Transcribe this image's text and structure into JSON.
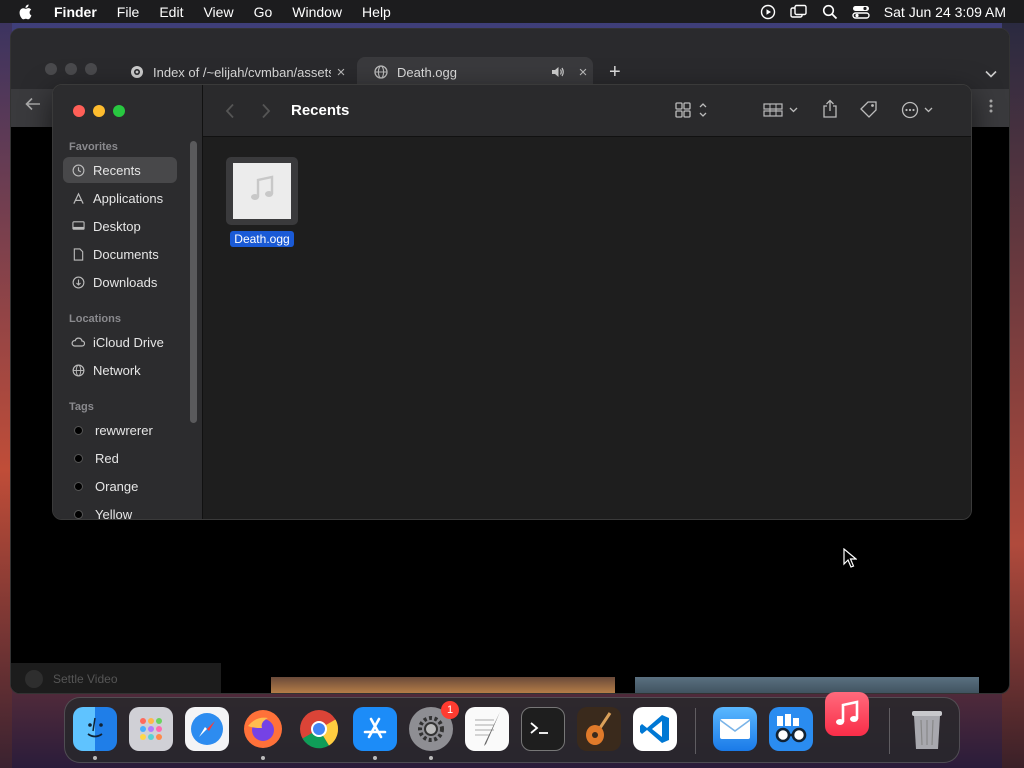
{
  "menubar": {
    "app_name": "Finder",
    "items": [
      "File",
      "Edit",
      "View",
      "Go",
      "Window",
      "Help"
    ],
    "clock": "Sat Jun 24  3:09 AM",
    "status_icons": [
      "screen-record-icon",
      "screen-mirroring-icon",
      "spotlight-icon",
      "control-center-icon"
    ]
  },
  "browser": {
    "tabs": [
      {
        "title": "Index of /~elijah/cvmban/assets",
        "icon": "tor-icon",
        "active": false
      },
      {
        "title": "Death.ogg",
        "icon": "globe-icon",
        "active": true,
        "playing": true
      }
    ],
    "new_tab_label": "+",
    "close_label": "×",
    "status_text": "Settle Video"
  },
  "finder": {
    "title": "Recents",
    "sidebar": {
      "favorites_label": "Favorites",
      "favorites": [
        {
          "label": "Recents",
          "icon": "clock-icon",
          "selected": true
        },
        {
          "label": "Applications",
          "icon": "applications-icon",
          "selected": false
        },
        {
          "label": "Desktop",
          "icon": "desktop-icon",
          "selected": false
        },
        {
          "label": "Documents",
          "icon": "document-icon",
          "selected": false
        },
        {
          "label": "Downloads",
          "icon": "download-icon",
          "selected": false
        }
      ],
      "locations_label": "Locations",
      "locations": [
        {
          "label": "iCloud Drive",
          "icon": "cloud-icon"
        },
        {
          "label": "Network",
          "icon": "network-icon"
        }
      ],
      "tags_label": "Tags",
      "tags": [
        {
          "label": "rewwrerer"
        },
        {
          "label": "Red"
        },
        {
          "label": "Orange"
        },
        {
          "label": "Yellow"
        }
      ]
    },
    "files": [
      {
        "name": "Death.ogg",
        "icon": "music-note-icon",
        "selected": true
      }
    ]
  },
  "dock": {
    "apps": [
      {
        "name": "Finder",
        "running": true
      },
      {
        "name": "Launchpad",
        "running": false
      },
      {
        "name": "Safari",
        "running": false
      },
      {
        "name": "Firefox",
        "running": true
      },
      {
        "name": "Chrome",
        "running": false
      },
      {
        "name": "App Store",
        "running": true
      },
      {
        "name": "System Settings",
        "running": true,
        "badge": "1"
      },
      {
        "name": "TextEdit",
        "running": false
      },
      {
        "name": "Terminal",
        "running": false
      },
      {
        "name": "GarageBand",
        "running": false
      },
      {
        "name": "Visual Studio Code",
        "running": false
      },
      {
        "name": "Mail",
        "running": false
      },
      {
        "name": "Preview Glasses",
        "running": false
      },
      {
        "name": "Music",
        "running": false
      },
      {
        "name": "Trash",
        "running": false
      }
    ]
  },
  "colors": {
    "accent": "#1a5ad6",
    "close": "#ff5f57",
    "minimize": "#febc2e",
    "zoom": "#28c840"
  }
}
